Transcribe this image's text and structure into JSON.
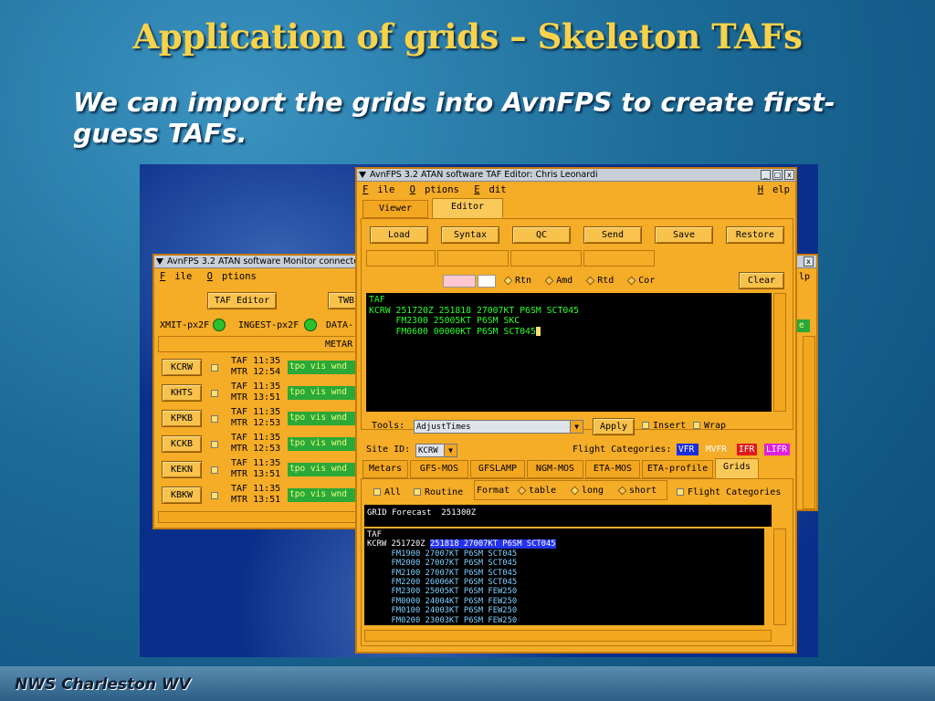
{
  "slide": {
    "title": "Application of grids – Skeleton TAFs",
    "bullet": "We can import the grids into AvnFPS to create first-guess TAFs.",
    "footer": "NWS Charleston WV"
  },
  "monitor_window": {
    "title": "AvnFPS 3.2 ATAN software Monitor connecte",
    "menu": [
      "File",
      "Options"
    ],
    "taf_editor_button": "TAF Editor",
    "twb_button": "TWB",
    "status": {
      "xmit": "XMIT-px2F",
      "ingest": "INGEST-px2F",
      "data": "DATA-"
    },
    "metar_header": "METAR",
    "sites": [
      {
        "id": "KCRW",
        "taf": "TAF 11:35",
        "mtr": "MTR 12:54",
        "cond": "tpo vis wnd"
      },
      {
        "id": "KHTS",
        "taf": "TAF 11:35",
        "mtr": "MTR 13:51",
        "cond": "tpo vis wnd"
      },
      {
        "id": "KPKB",
        "taf": "TAF 11:35",
        "mtr": "MTR 12:53",
        "cond": "tpo vis wnd"
      },
      {
        "id": "KCKB",
        "taf": "TAF 11:35",
        "mtr": "MTR 12:53",
        "cond": "tpo vis wnd"
      },
      {
        "id": "KEKN",
        "taf": "TAF 11:35",
        "mtr": "MTR 13:51",
        "cond": "tpo vis wnd"
      },
      {
        "id": "KBKW",
        "taf": "TAF 11:35",
        "mtr": "MTR 13:51",
        "cond": "tpo vis wnd"
      }
    ],
    "right_edge_menu": "lp"
  },
  "editor_window": {
    "title": "AvnFPS 3.2 ATAN software TAF Editor: Chris Leonardi",
    "window_buttons": [
      "_",
      "□",
      "x"
    ],
    "menu": {
      "file": "File",
      "options": "Options",
      "edit": "Edit",
      "help": "Help"
    },
    "tabs": [
      "Viewer",
      "Editor"
    ],
    "toolbar": [
      "Load",
      "Syntax",
      "QC",
      "Send",
      "Save",
      "Restore"
    ],
    "radios": [
      "Rtn",
      "Amd",
      "Rtd",
      "Cor"
    ],
    "clear_button": "Clear",
    "editor_text": [
      "TAF",
      "KCRW 251720Z 251818 27007KT P6SM SCT045",
      "     FM2300 25005KT P6SM SKC",
      "     FM0600 00000KT P6SM SCT045"
    ],
    "tools_label": "Tools:",
    "tools_value": "AdjustTimes",
    "apply_button": "Apply",
    "insert_label": "Insert",
    "wrap_label": "Wrap",
    "site_id_label": "Site ID:",
    "site_id_value": "KCRW",
    "flight_categories_label": "Flight Categories:",
    "categories": [
      {
        "label": "VFR",
        "bg": "#1a2ee0",
        "fg": "#ffffff"
      },
      {
        "label": "MVFR",
        "bg": "#f5ac26",
        "fg": "#ffffff"
      },
      {
        "label": "IFR",
        "bg": "#e01a1a",
        "fg": "#ffffff"
      },
      {
        "label": "LIFR",
        "bg": "#e020e0",
        "fg": "#ffffff"
      }
    ],
    "guidance_tabs": [
      "Metars",
      "GFS-MOS",
      "GFSLAMP",
      "NGM-MOS",
      "ETA-MOS",
      "ETA-profile",
      "Grids"
    ],
    "options": {
      "all": "All",
      "routine": "Routine",
      "format": "Format",
      "table": "table",
      "long": "long",
      "short": "short",
      "flight_categories": "Flight Categories"
    },
    "grid_header": "GRID Forecast  251300Z",
    "grid_first_prefix": "KCRW 251720Z ",
    "grid_first_highlight": "251818 27007KT P6SM SCT045",
    "grid_lines": [
      "TAF",
      "     FM1900 27007KT P6SM SCT045",
      "     FM2000 27007KT P6SM SCT045",
      "     FM2100 27007KT P6SM SCT045",
      "     FM2200 26006KT P6SM SCT045",
      "     FM2300 25005KT P6SM FEW250",
      "     FM0000 24004KT P6SM FEW250",
      "     FM0100 24003KT P6SM FEW250",
      "     FM0200 23003KT P6SM FEW250"
    ]
  }
}
